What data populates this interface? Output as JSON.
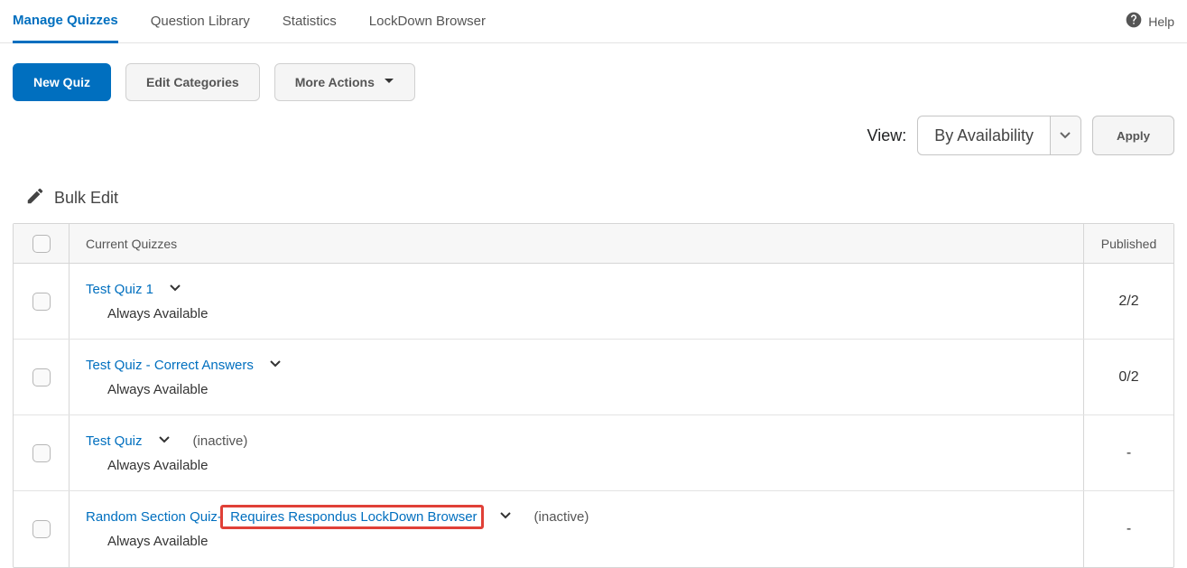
{
  "tabs": {
    "manage": "Manage Quizzes",
    "library": "Question Library",
    "stats": "Statistics",
    "lockdown": "LockDown Browser"
  },
  "help_label": "Help",
  "toolbar": {
    "new_quiz": "New Quiz",
    "edit_categories": "Edit Categories",
    "more_actions": "More Actions"
  },
  "view": {
    "label": "View:",
    "selected": "By Availability",
    "apply": "Apply"
  },
  "bulk_edit": "Bulk Edit",
  "columns": {
    "name": "Current Quizzes",
    "published": "Published"
  },
  "rows": [
    {
      "title": "Test Quiz 1",
      "suffix": "",
      "inactive": "",
      "availability": "Always Available",
      "published": "2/2",
      "highlight_suffix": false
    },
    {
      "title": "Test Quiz - Correct Answers",
      "suffix": "",
      "inactive": "",
      "availability": "Always Available",
      "published": "0/2",
      "highlight_suffix": false
    },
    {
      "title": "Test Quiz",
      "suffix": "",
      "inactive": "(inactive)",
      "availability": "Always Available",
      "published": "-",
      "highlight_suffix": false
    },
    {
      "title": "Random Section Quiz-",
      "suffix": " Requires Respondus LockDown Browser",
      "inactive": "(inactive)",
      "availability": "Always Available",
      "published": "-",
      "highlight_suffix": true
    }
  ]
}
